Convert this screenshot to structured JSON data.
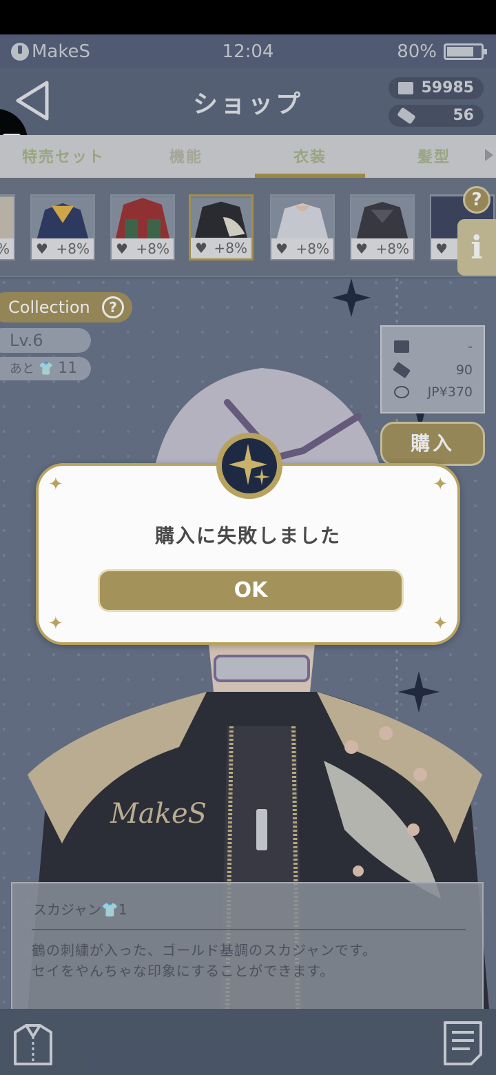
{
  "status_bar": {
    "app_name": "MakeS",
    "time": "12:04",
    "battery": "80%"
  },
  "header": {
    "title": "ショップ",
    "currency_coins": "59985",
    "currency_tickets": "56"
  },
  "tabs": [
    {
      "label": "特売セット"
    },
    {
      "label": "機能"
    },
    {
      "label": "衣装"
    },
    {
      "label": "髪型"
    }
  ],
  "items": [
    {
      "bonus": "%"
    },
    {
      "bonus": "+8%"
    },
    {
      "bonus": "+8%"
    },
    {
      "bonus": "+8%"
    },
    {
      "bonus": "+8%"
    },
    {
      "bonus": "+8%"
    }
  ],
  "collection": {
    "label": "Collection",
    "level": "Lv.6",
    "remain_label": "あと",
    "remain_count": "11"
  },
  "price": {
    "coins": "-",
    "tickets": "90",
    "yen": "JP¥370"
  },
  "buy_label": "購入",
  "jacket_text": "MakeS",
  "description": {
    "name": "スカジャン",
    "name_suffix": "1",
    "line1": "鶴の刺繍が入った、ゴールド基調のスカジャンです。",
    "line2": "セイをやんちゃな印象にすることができます。"
  },
  "dialog": {
    "message": "購入に失敗しました",
    "ok_label": "OK"
  },
  "colors": {
    "gold": "#a3925a",
    "navy": "#1e2a44",
    "background": "#687489"
  }
}
